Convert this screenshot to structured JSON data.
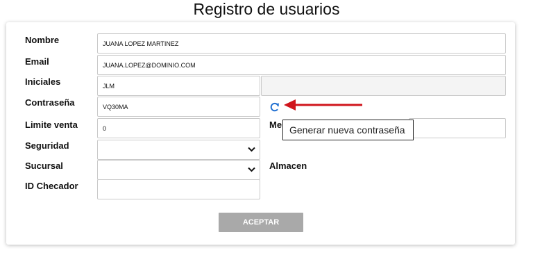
{
  "page": {
    "title": "Registro de usuarios"
  },
  "form": {
    "nombre": {
      "label": "Nombre",
      "value": "JUANA LOPEZ MARTINEZ"
    },
    "email": {
      "label": "Email",
      "value": "JUANA.LOPEZ@DOMINIO.COM"
    },
    "iniciales": {
      "label": "Iniciales",
      "value": "JLM",
      "extra_value": ""
    },
    "contrasena": {
      "label": "Contraseña",
      "value": "VQ30MA",
      "regenerate_icon": "refresh-icon"
    },
    "limite_venta": {
      "label": "Limite venta",
      "value": "0"
    },
    "meta": {
      "label_visible": "Me",
      "value": ""
    },
    "seguridad": {
      "label": "Seguridad",
      "value": ""
    },
    "sucursal": {
      "label": "Sucursal",
      "value": ""
    },
    "almacen": {
      "label": "Almacen"
    },
    "id_checador": {
      "label": "ID Checador",
      "value": ""
    },
    "accept_label": "ACEPTAR"
  },
  "tooltip": {
    "text": "Generar nueva contraseña"
  },
  "annotation": {
    "arrow_color": "#d0151c"
  },
  "colors": {
    "icon_blue": "#1f6fd1",
    "button_bg": "#a9a9a9"
  }
}
